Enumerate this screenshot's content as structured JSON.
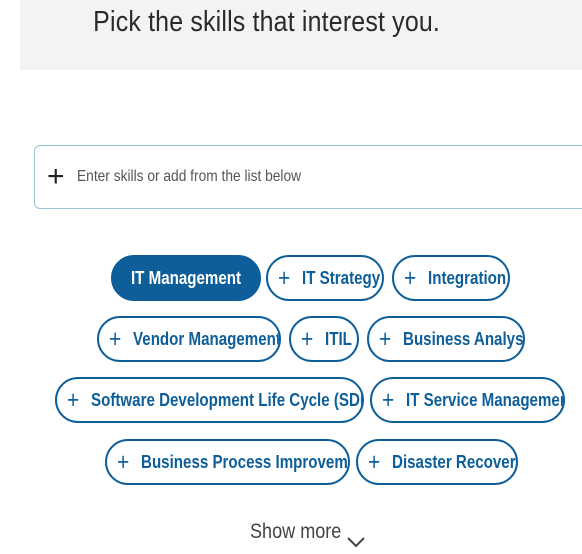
{
  "header": {
    "title": "Pick the skills that interest you."
  },
  "search": {
    "placeholder": "Enter skills or add from the list below",
    "value": "",
    "add_icon": "plus-icon"
  },
  "skills": [
    {
      "label": "IT Management",
      "selected": true
    },
    {
      "label": "IT Strategy",
      "selected": false
    },
    {
      "label": "Integration",
      "selected": false
    },
    {
      "label": "Vendor Management",
      "selected": false
    },
    {
      "label": "ITIL",
      "selected": false
    },
    {
      "label": "Business Analysis",
      "selected": false
    },
    {
      "label": "Software Development Life Cycle (SDLC)",
      "selected": false
    },
    {
      "label": "IT Service Management",
      "selected": false
    },
    {
      "label": "Business Process Improvement",
      "selected": false
    },
    {
      "label": "Disaster Recovery",
      "selected": false
    }
  ],
  "show_more": {
    "label": "Show more",
    "icon": "chevron-down-icon"
  },
  "colors": {
    "accent": "#0e5f99",
    "header_background": "#f3f3f3",
    "input_border": "#9ac3dd"
  }
}
